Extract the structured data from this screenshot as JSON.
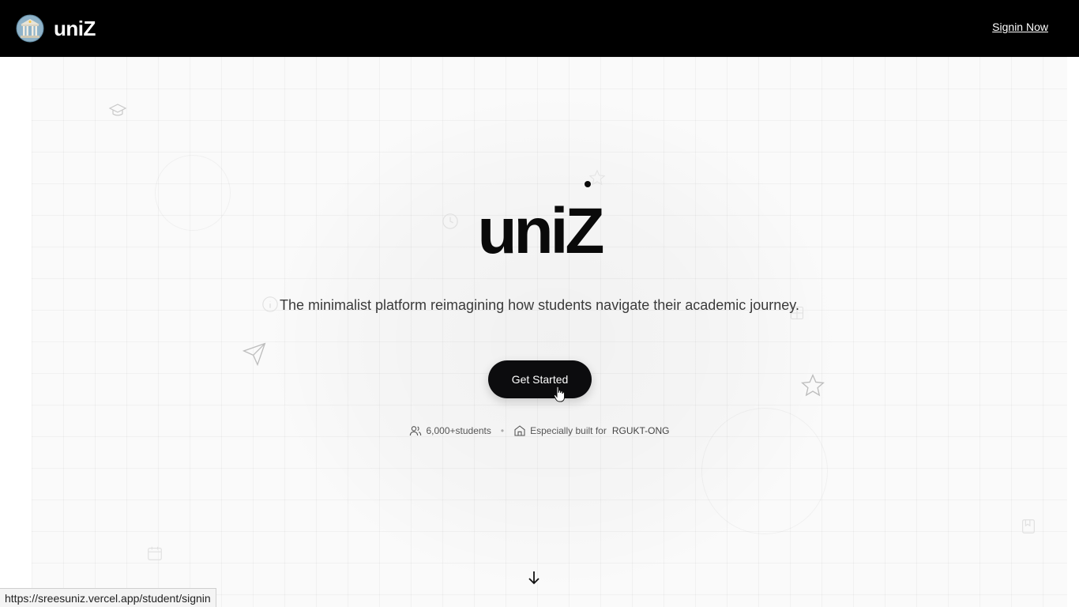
{
  "header": {
    "brand_name": "uniZ",
    "signin_label": "Signin Now"
  },
  "hero": {
    "title": "uniZ",
    "tagline": "The minimalist platform reimagining how students navigate their academic journey.",
    "cta_label": "Get Started",
    "stats": {
      "students_count": "6,000+",
      "students_label": "students",
      "built_for_label": "Especially built for",
      "built_for_target": "RGUKT-ONG"
    },
    "decorations": [
      "graduation-cap-icon",
      "clock-icon",
      "info-icon",
      "paper-plane-icon",
      "star-icon",
      "grid-icon",
      "calendar-icon",
      "bookmark-icon"
    ]
  },
  "status_bar": {
    "url": "https://sreesuniz.vercel.app/student/signin"
  },
  "colors": {
    "header_bg": "#000000",
    "cta_bg": "#0c0c0e",
    "text_primary": "#0a0a0a",
    "text_muted": "#555555"
  }
}
